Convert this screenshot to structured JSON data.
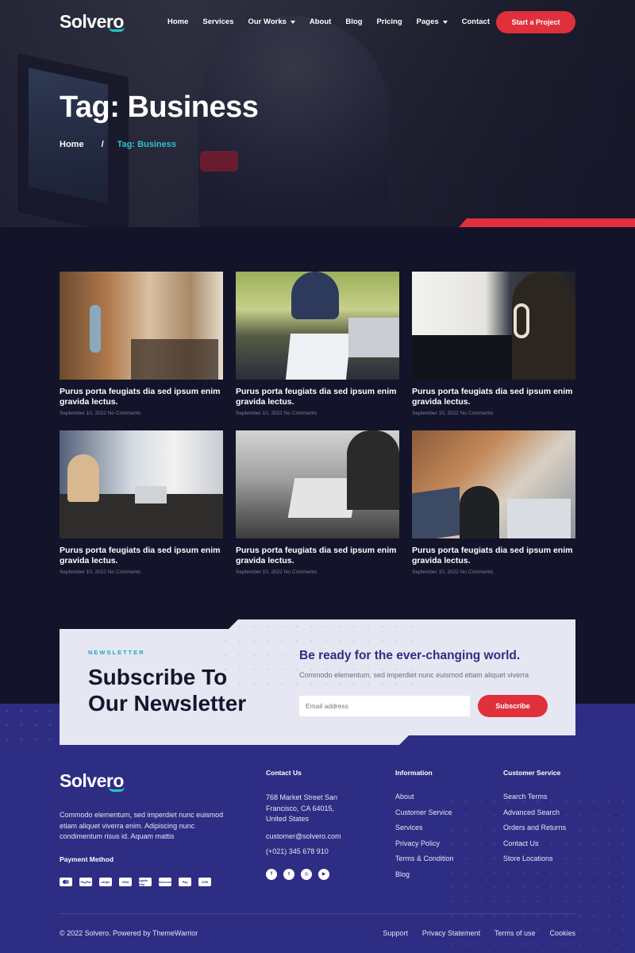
{
  "brand": {
    "name": "Solvero"
  },
  "nav": {
    "items": [
      {
        "label": "Home",
        "dropdown": false
      },
      {
        "label": "Services",
        "dropdown": false
      },
      {
        "label": "Our Works",
        "dropdown": true
      },
      {
        "label": "About",
        "dropdown": false
      },
      {
        "label": "Blog",
        "dropdown": false
      },
      {
        "label": "Pricing",
        "dropdown": false
      },
      {
        "label": "Pages",
        "dropdown": true
      },
      {
        "label": "Contact",
        "dropdown": false
      }
    ],
    "cta_label": "Start a Project"
  },
  "hero": {
    "title": "Tag: Business",
    "breadcrumb": {
      "home": "Home",
      "separator": "/",
      "current": "Tag: Business"
    }
  },
  "posts": [
    {
      "title": "Purus porta feugiats dia sed ipsum enim gravida lectus.",
      "meta": "September 10, 2022 No Comments"
    },
    {
      "title": "Purus porta feugiats dia sed ipsum enim gravida lectus.",
      "meta": "September 10, 2022 No Comments"
    },
    {
      "title": "Purus porta feugiats dia sed ipsum enim gravida lectus.",
      "meta": "September 10, 2022 No Comments"
    },
    {
      "title": "Purus porta feugiats dia sed ipsum enim gravida lectus.",
      "meta": "September 10, 2022 No Comments"
    },
    {
      "title": "Purus porta feugiats dia sed ipsum enim gravida lectus.",
      "meta": "September 10, 2022 No Comments"
    },
    {
      "title": "Purus porta feugiats dia sed ipsum enim gravida lectus.",
      "meta": "September 10, 2022 No Comments"
    }
  ],
  "newsletter": {
    "eyebrow": "NEWSLETTER",
    "title_line1": "Subscribe To",
    "title_line2": "Our Newsletter",
    "headline": "Be ready for the ever-changing world.",
    "description": "Commodo elementum, sed imperdiet nunc euismod etiam aliquet viverra",
    "email_placeholder": "Email address",
    "button_label": "Subscribe"
  },
  "footer": {
    "about": "Commodo elementum, sed imperdiet nunc euismod etiam aliquet viverra enim. Adipiscing nunc condimentum risus id. Aquam mattis",
    "payment_title": "Payment Method",
    "payment_methods": [
      "Mastercard",
      "PayPal",
      "stripe",
      "VISA",
      "Apple Pay",
      "Discover",
      "Pay",
      "JCB"
    ],
    "contact": {
      "title": "Contact Us",
      "address": "768 Market Street San Francisco, CA 64015, United States",
      "email": "customer@solvero.com",
      "phone": "(+021) 345 678 910",
      "socials": [
        "facebook-icon",
        "twitter-icon",
        "instagram-icon",
        "youtube-icon"
      ]
    },
    "information": {
      "title": "Information",
      "links": [
        "About",
        "Customer Service",
        "Services",
        "Privacy Policy",
        "Terms & Condition",
        "Blog"
      ]
    },
    "customer_service": {
      "title": "Customer Service",
      "links": [
        "Search Terms",
        "Advanced Search",
        "Orders and Returns",
        "Contact Us",
        "Store Locations"
      ]
    },
    "copyright": "© 2022 Solvero. Powered by ThemeWarrior",
    "bottom_links": [
      "Support",
      "Privacy Statement",
      "Terms of use",
      "Cookies"
    ]
  },
  "colors": {
    "accent_red": "#e0303c",
    "accent_teal": "#2ac3d1",
    "footer_blue": "#2e2d84",
    "page_dark": "#13142a"
  }
}
